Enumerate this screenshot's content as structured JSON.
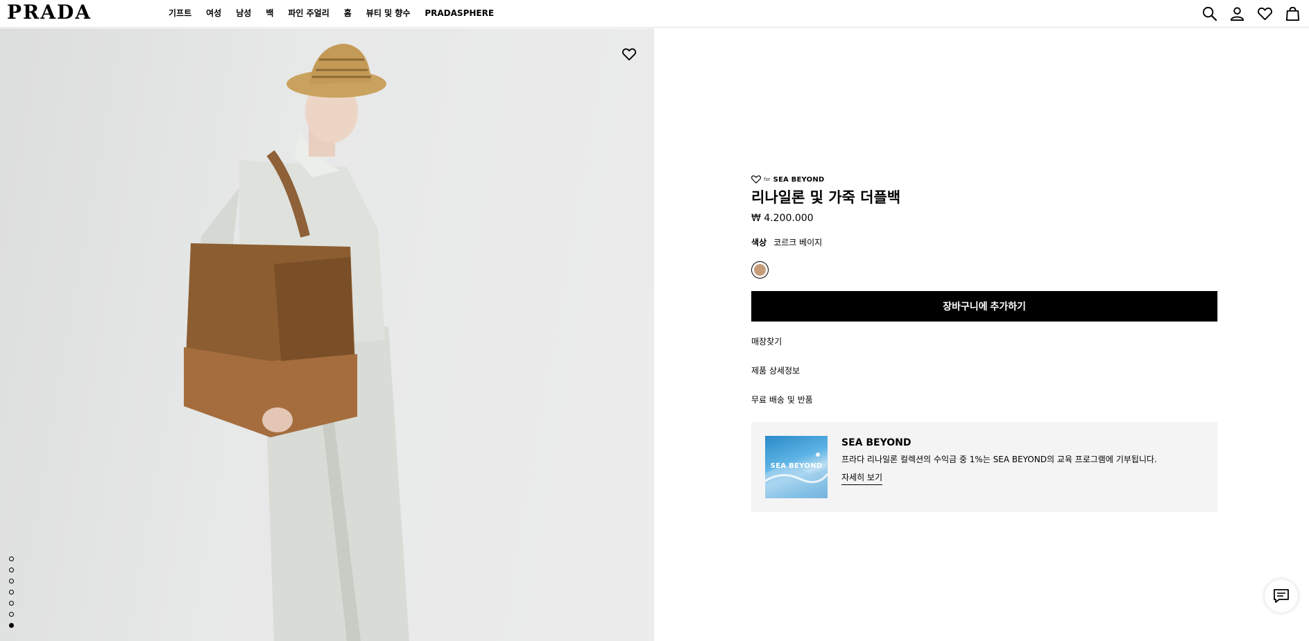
{
  "header": {
    "logo": "PRADA",
    "nav": [
      "기프트",
      "여성",
      "남성",
      "백",
      "파인 주얼리",
      "홈",
      "뷰티 및 향수",
      "PRADASPHERE"
    ],
    "icons": [
      "search-icon",
      "account-icon",
      "wishlist-icon",
      "shopping-bag-icon"
    ]
  },
  "gallery": {
    "image_count": 7,
    "active_index": 6,
    "image_description_colors": {
      "background": "#e6e7e7",
      "bag": "#8a5a30"
    }
  },
  "product": {
    "brand_for": "for",
    "brand_name": "SEA BEYOND",
    "title": "리나일론 및 가죽 더플백",
    "price": "₩ 4.200.000",
    "color_label": "색상",
    "color_value": "코르크 베이지",
    "swatch_color": "#c69d7a",
    "add_to_cart": "장바구니에 추가하기",
    "links": [
      "매장찾기",
      "제품 상세정보",
      "무료 배송 및 반품"
    ]
  },
  "sea_beyond": {
    "image_text": "SEA BEYOND",
    "title": "SEA BEYOND",
    "description": "프라다 리나일론 컬렉션의 수익금 중 1%는 SEA BEYOND의 교육 프로그램에 기부됩니다.",
    "link": "자세히 보기"
  },
  "colors": {
    "accent": "#000000",
    "card_bg": "#f4f4f4"
  }
}
